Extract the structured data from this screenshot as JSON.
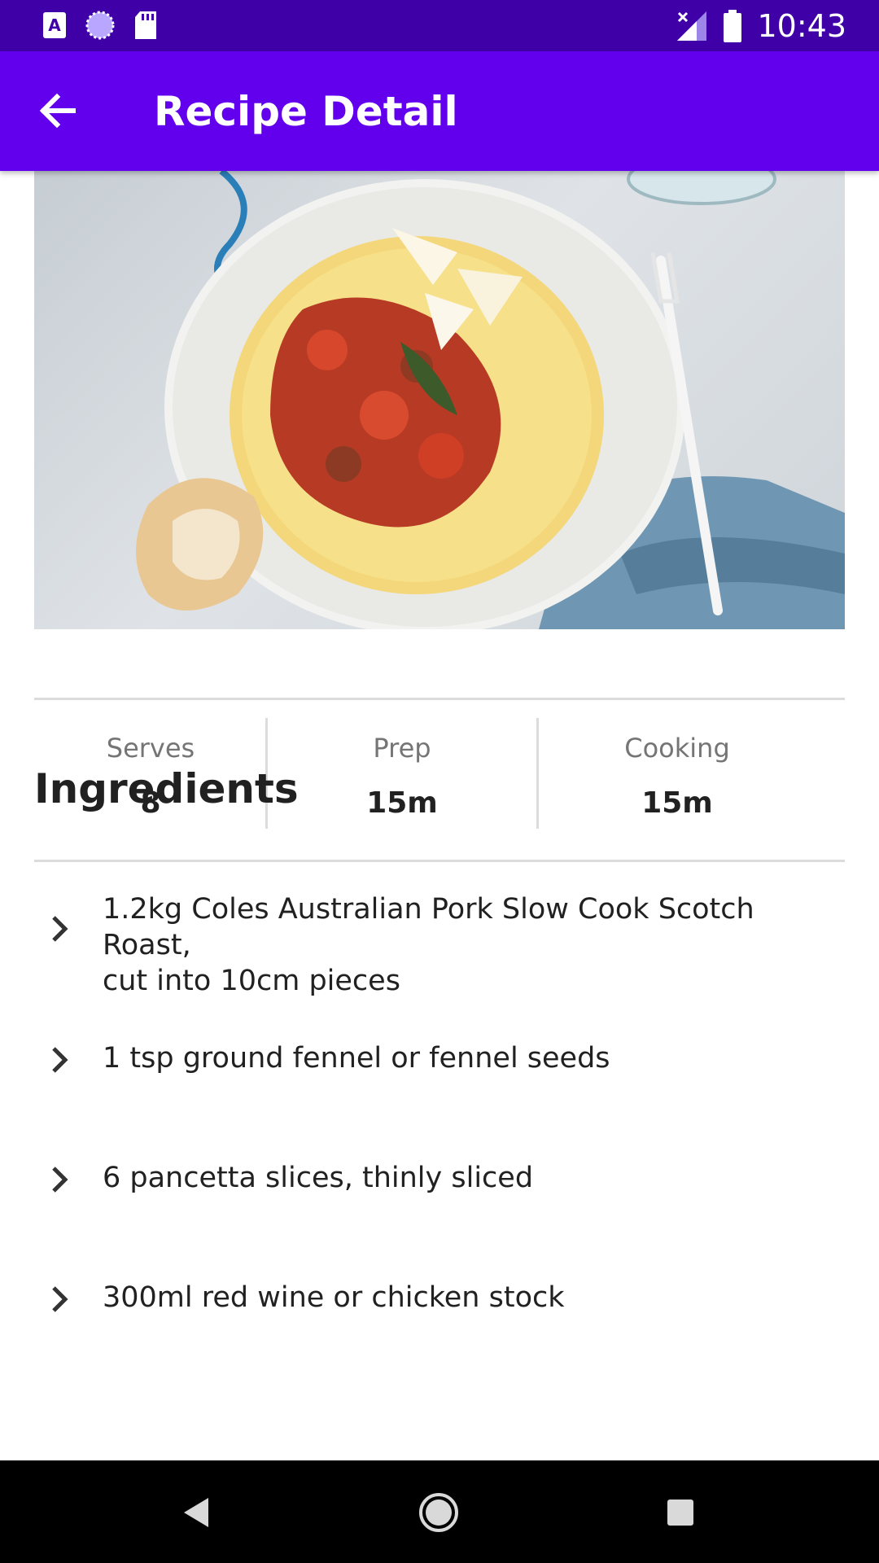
{
  "status_bar": {
    "time": "10:43",
    "left_icons": [
      "a-box-icon",
      "loading-circle-icon",
      "sd-card-icon"
    ],
    "right_icons": [
      "no-signal-icon",
      "battery-icon"
    ]
  },
  "app_bar": {
    "title": "Recipe Detail",
    "color": "#6200ee",
    "status_color": "#3f00a7"
  },
  "hero_image": {
    "icon": "dish-photo"
  },
  "stats": [
    {
      "label": "Serves",
      "value": "8"
    },
    {
      "label": "Prep",
      "value": "15m"
    },
    {
      "label": "Cooking",
      "value": "15m"
    }
  ],
  "ingredients": {
    "title": "Ingredients",
    "items": [
      {
        "line1": "1.2kg Coles Australian Pork Slow Cook Scotch Roast,",
        "line2": "cut into 10cm pieces"
      },
      {
        "line1": "1 tsp ground fennel or fennel seeds"
      },
      {
        "line1": "6 pancetta slices, thinly sliced"
      },
      {
        "line1": "300ml red wine or chicken stock"
      }
    ]
  },
  "nav_bar": {
    "icons": [
      "back-triangle-icon",
      "home-circle-icon",
      "recents-square-icon"
    ]
  }
}
